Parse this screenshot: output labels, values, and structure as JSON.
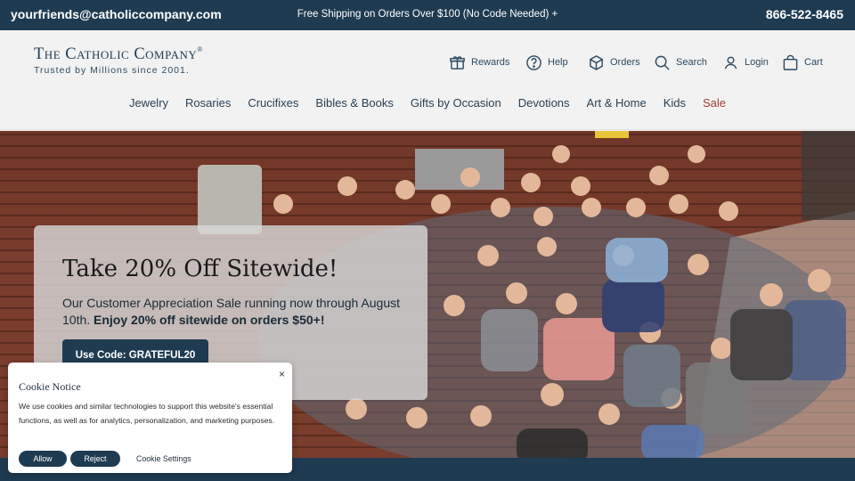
{
  "topbar": {
    "email": "yourfriends@catholiccompany.com",
    "promo": "Free Shipping on Orders Over $100 (No Code Needed) +",
    "phone": "866-522-8465"
  },
  "header": {
    "brand": "The Catholic Company",
    "reg": "®",
    "tagline": "Trusted by Millions since 2001.",
    "utility": {
      "rewards": "Rewards",
      "help": "Help",
      "orders": "Orders",
      "search": "Search",
      "login": "Login",
      "cart": "Cart"
    },
    "nav": [
      {
        "label": "Jewelry"
      },
      {
        "label": "Rosaries"
      },
      {
        "label": "Crucifixes"
      },
      {
        "label": "Bibles & Books"
      },
      {
        "label": "Gifts by Occasion"
      },
      {
        "label": "Devotions"
      },
      {
        "label": "Art & Home"
      },
      {
        "label": "Kids"
      },
      {
        "label": "Sale"
      }
    ],
    "sale_color": "#a13d32"
  },
  "hero": {
    "headline": "Take 20% Off Sitewide!",
    "sub_plain": "Our Customer Appreciation Sale running now through August 10th.",
    "sub_bold": "Enjoy 20% off sitewide on orders $50+!",
    "code_button": "Use Code: GRATEFUL20"
  },
  "cookie": {
    "title": "Cookie Notice",
    "close": "×",
    "body": "We use cookies and similar technologies to support this website's essential functions, as well as for analytics, personalization, and marketing purposes.",
    "allow": "Allow",
    "reject": "Reject",
    "settings": "Cookie Settings"
  },
  "colors": {
    "navy": "#1f3b51",
    "background": "#f2f2f2"
  }
}
